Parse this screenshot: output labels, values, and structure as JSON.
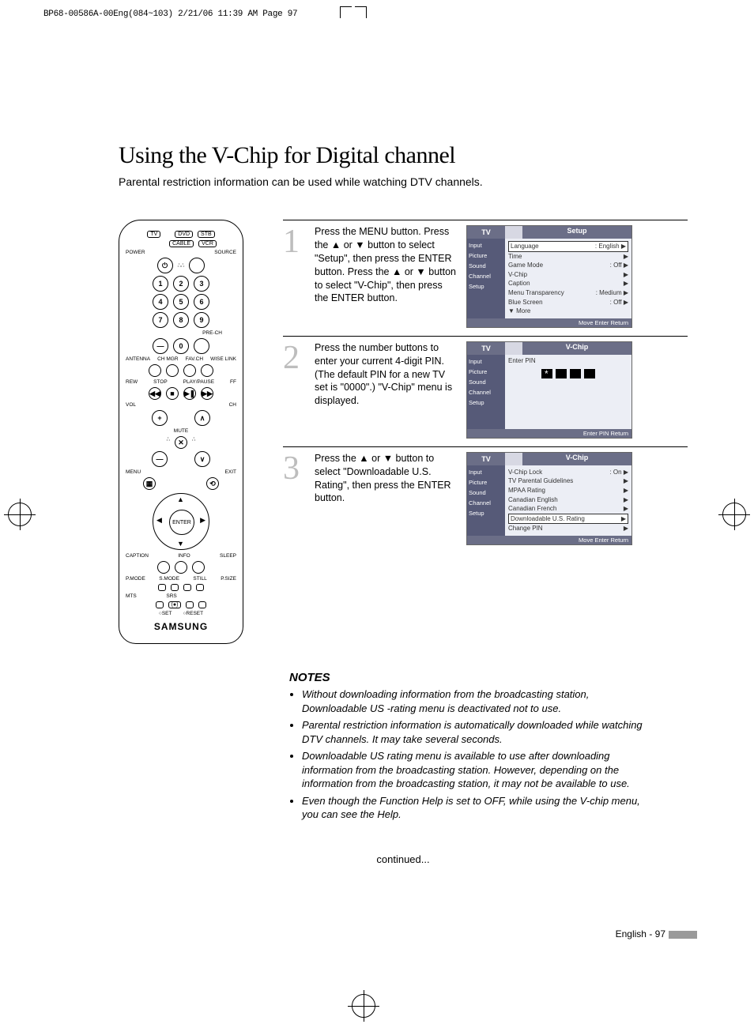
{
  "print_header": "BP68-00586A-00Eng(084~103)  2/21/06  11:39 AM  Page 97",
  "title": "Using the V-Chip for Digital channel",
  "subtitle": "Parental restriction information can be used while watching DTV channels.",
  "remote": {
    "top_buttons": [
      "TV",
      "DVD",
      "STB",
      "CABLE",
      "VCR"
    ],
    "power": "POWER",
    "source": "SOURCE",
    "numbers": [
      "1",
      "2",
      "3",
      "4",
      "5",
      "6",
      "7",
      "8",
      "9",
      "0"
    ],
    "prech": "PRE-CH",
    "row_labels": [
      "ANTENNA",
      "CH MGR",
      "FAV.CH",
      "WISE LINK"
    ],
    "transport": [
      "REW",
      "STOP",
      "PLAY/PAUSE",
      "FF"
    ],
    "vol": "VOL",
    "ch": "CH",
    "mute": "MUTE",
    "menu": "MENU",
    "exit": "EXIT",
    "enter": "ENTER",
    "caption": "CAPTION",
    "info": "INFO",
    "sleep": "SLEEP",
    "row2": [
      "P.MODE",
      "S.MODE",
      "STILL",
      "P.SIZE"
    ],
    "row3": [
      "MTS",
      "SRS"
    ],
    "setreset": [
      "SET",
      "RESET"
    ],
    "brand": "SAMSUNG"
  },
  "steps": [
    {
      "num": "1",
      "text": "Press the MENU button.\nPress the ▲ or ▼ button to select \"Setup\", then press the ENTER button.\nPress the ▲ or ▼ button to select \"V-Chip\", then press the ENTER button.",
      "osd": {
        "tv_tab": "TV",
        "section": "Setup",
        "side": [
          "Input",
          "Picture",
          "Sound",
          "Channel",
          "Setup"
        ],
        "rows": [
          {
            "l": "Language",
            "r": ": English"
          },
          {
            "l": "Time",
            "r": ""
          },
          {
            "l": "Game Mode",
            "r": ": Off"
          },
          {
            "l": "V-Chip",
            "r": ""
          },
          {
            "l": "Caption",
            "r": ""
          },
          {
            "l": "Menu Transparency",
            "r": ": Medium"
          },
          {
            "l": "Blue Screen",
            "r": ": Off"
          },
          {
            "l": "▼ More",
            "r": ""
          }
        ],
        "footer": "Move    Enter    Return"
      }
    },
    {
      "num": "2",
      "text": "Press the number buttons to enter your current 4-digit PIN. (The default PIN for a new TV set is \"0000\".) \"V-Chip\" menu is displayed.",
      "osd": {
        "tv_tab": "TV",
        "section": "V-Chip",
        "side": [
          "Input",
          "Picture",
          "Sound",
          "Channel",
          "Setup"
        ],
        "enter_pin_label": "Enter PIN",
        "footer": "Enter PIN    Return"
      }
    },
    {
      "num": "3",
      "text": "Press the ▲ or ▼ button to select \"Downloadable U.S. Rating\", then press the ENTER button.",
      "osd": {
        "tv_tab": "TV",
        "section": "V-Chip",
        "side": [
          "Input",
          "Picture",
          "Sound",
          "Channel",
          "Setup"
        ],
        "rows": [
          {
            "l": "V-Chip Lock",
            "r": ": On"
          },
          {
            "l": "TV Parental Guidelines",
            "r": ""
          },
          {
            "l": "MPAA Rating",
            "r": ""
          },
          {
            "l": "Canadian English",
            "r": ""
          },
          {
            "l": "Canadian French",
            "r": ""
          },
          {
            "l": "Downloadable U.S. Rating",
            "r": "",
            "hl": true
          },
          {
            "l": "Change PIN",
            "r": ""
          }
        ],
        "footer": "Move    Enter    Return"
      }
    }
  ],
  "notes_heading": "NOTES",
  "notes": [
    "Without downloading information from the broadcasting station, Downloadable US -rating menu is deactivated not to use.",
    "Parental restriction information is automatically downloaded while watching DTV channels. It may take several seconds.",
    "Downloadable US rating menu is available to use after downloading information from the broadcasting station. However, depending on the information from the broadcasting station, it may not be available to use.",
    "Even though the Function Help is set to OFF, while using the V-chip menu, you can see the Help."
  ],
  "continued": "continued...",
  "page_number": "English - 97"
}
